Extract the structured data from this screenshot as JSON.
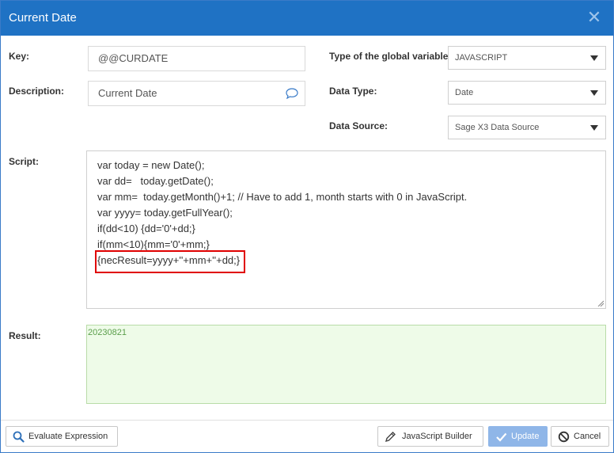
{
  "dialog": {
    "title": "Current Date",
    "close_glyph": "✕"
  },
  "form": {
    "key": {
      "label": "Key:",
      "value": "@@CURDATE"
    },
    "description": {
      "label": "Description:",
      "value": "Current Date",
      "icon": "comment-icon"
    },
    "global_var_type": {
      "label": "Type of the global variable:",
      "value": "JAVASCRIPT"
    },
    "data_type": {
      "label": "Data Type:",
      "value": "Date"
    },
    "data_source": {
      "label": "Data Source:",
      "value": "Sage X3 Data Source"
    },
    "script": {
      "label": "Script:",
      "lines": [
        "var today = new Date();",
        "var dd=   today.getDate();",
        "var mm=  today.getMonth()+1; // Have to add 1, month starts with 0 in JavaScript.",
        "var yyyy= today.getFullYear();",
        "if(dd<10) {dd='0'+dd;}",
        "if(mm<10){mm='0'+mm;}",
        "{necResult=yyyy+''+mm+''+dd;}"
      ]
    },
    "result": {
      "label": "Result:",
      "value": "20230821"
    }
  },
  "footer": {
    "evaluate_label": "Evaluate Expression",
    "js_builder_label": "JavaScript Builder",
    "update_label": "Update",
    "cancel_label": "Cancel"
  },
  "colors": {
    "titlebar": "#1f72c4",
    "highlight_border": "#e00000",
    "result_bg": "#eefbe8",
    "primary_button": "#8fb6e8"
  }
}
